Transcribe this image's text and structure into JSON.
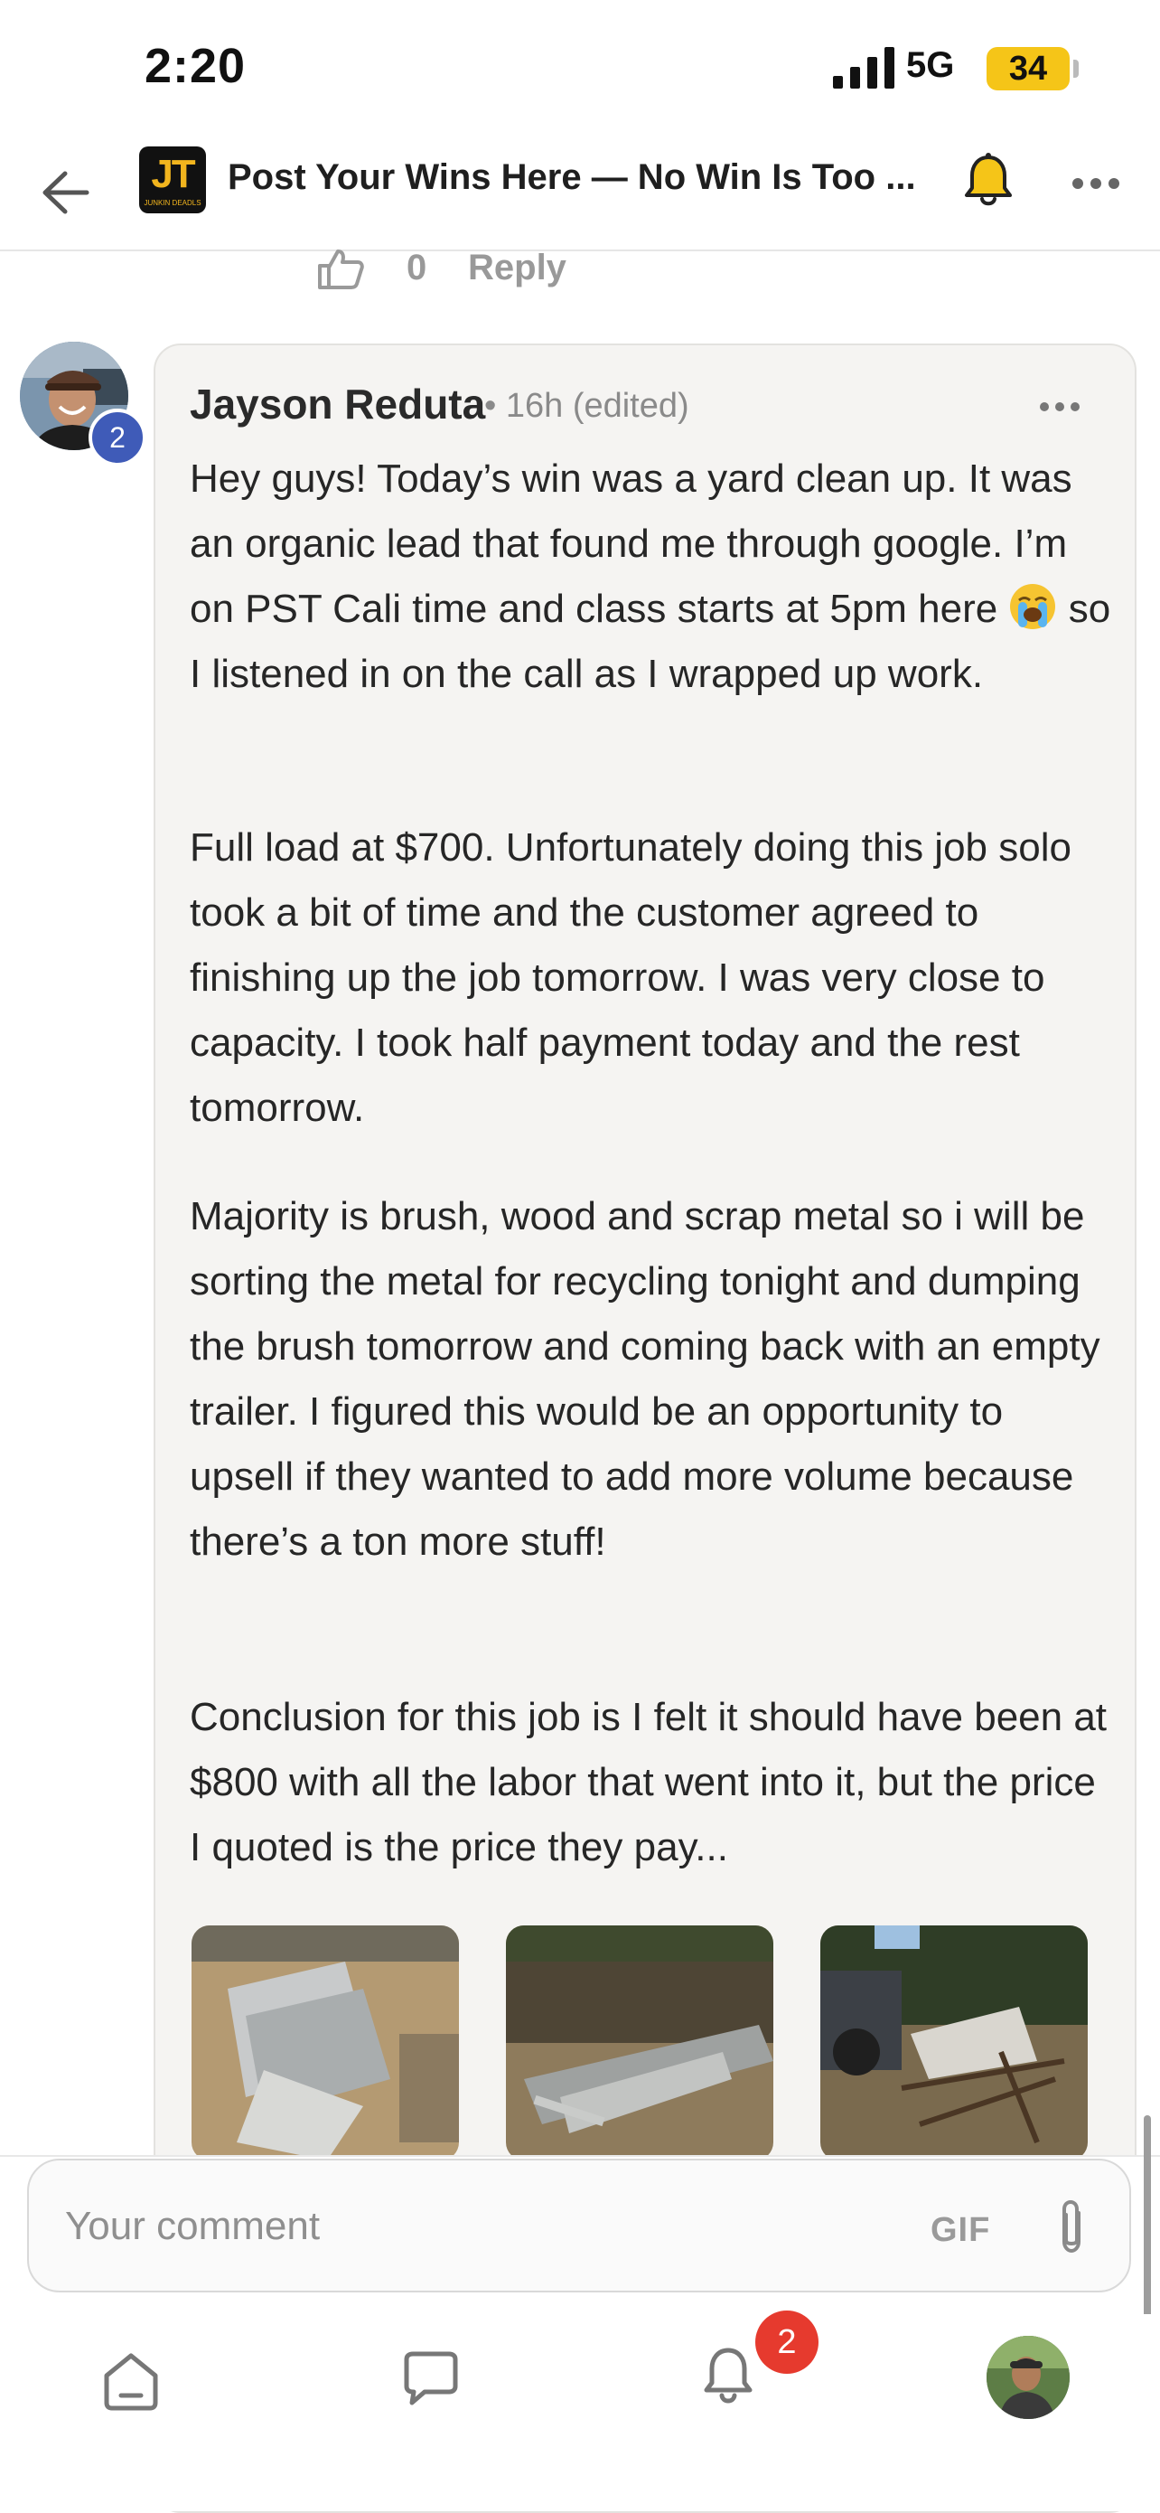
{
  "status_bar": {
    "time": "2:20",
    "network": "5G",
    "battery": "34"
  },
  "header": {
    "title": "Post Your Wins Here — No Win Is Too ...",
    "group_logo_text": "JT",
    "group_logo_subtext": "JUNKIN DEADLS"
  },
  "previous_comment": {
    "like_count": "0",
    "reply_label": "Reply"
  },
  "comment": {
    "author": "Jayson Reduta",
    "meta": "• 16h (edited)",
    "avatar_badge": "2",
    "paragraphs": [
      "Hey guys! Today’s win was a yard clean up. It was an organic lead that found me through google. I’m on PST Cali time and class starts at 5pm here",
      " so I listened in on the call as I wrapped up work.",
      "Full load at $700. Unfortunately doing this job solo took a bit of time and the customer agreed to finishing up the job tomorrow. I was very close to capacity. I took half payment today and the rest tomorrow.",
      "Majority is brush, wood and scrap metal so i will be sorting the metal for recycling tonight and dumping the brush tomorrow and coming back with an empty trailer. I figured this would be an opportunity to upsell if they wanted to add more volume because there’s a ton more stuff!",
      "Conclusion for this job is I felt it should have been at $800 with all the labor that went into it, but the price I quoted is the price they pay..."
    ],
    "emoji": "loudly-crying-face"
  },
  "composer": {
    "placeholder": "Your comment",
    "gif_label": "GIF"
  },
  "bottom_nav": {
    "notification_count": "2"
  },
  "colors": {
    "accent_badge": "#3f5bb8",
    "notification_badge": "#e63a2e",
    "battery": "#f5c518",
    "bubble_bg": "#f5f4f2"
  }
}
